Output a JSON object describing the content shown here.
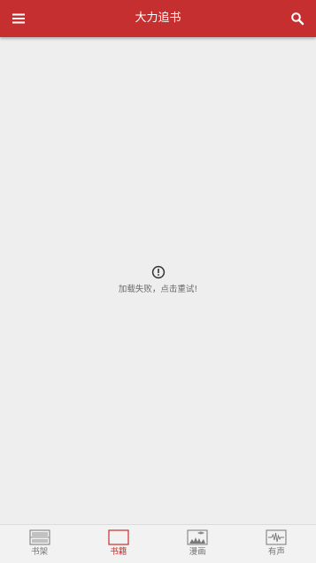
{
  "app_bar": {
    "title": "大力追书",
    "menu_icon": "hamburger-menu-icon",
    "search_icon": "search-icon",
    "background": "#c62f2f"
  },
  "content": {
    "error_icon": "alert-circle-icon",
    "error_message": "加载失败，点击重试!"
  },
  "bottom_nav": {
    "active_color": "#c62f2f",
    "items": [
      {
        "label": "书架",
        "icon": "bookshelf-icon",
        "active": false
      },
      {
        "label": "书籍",
        "icon": "books-icon",
        "active": true
      },
      {
        "label": "漫画",
        "icon": "comic-icon",
        "active": false
      },
      {
        "label": "有声",
        "icon": "audio-wave-icon",
        "active": false
      }
    ]
  }
}
